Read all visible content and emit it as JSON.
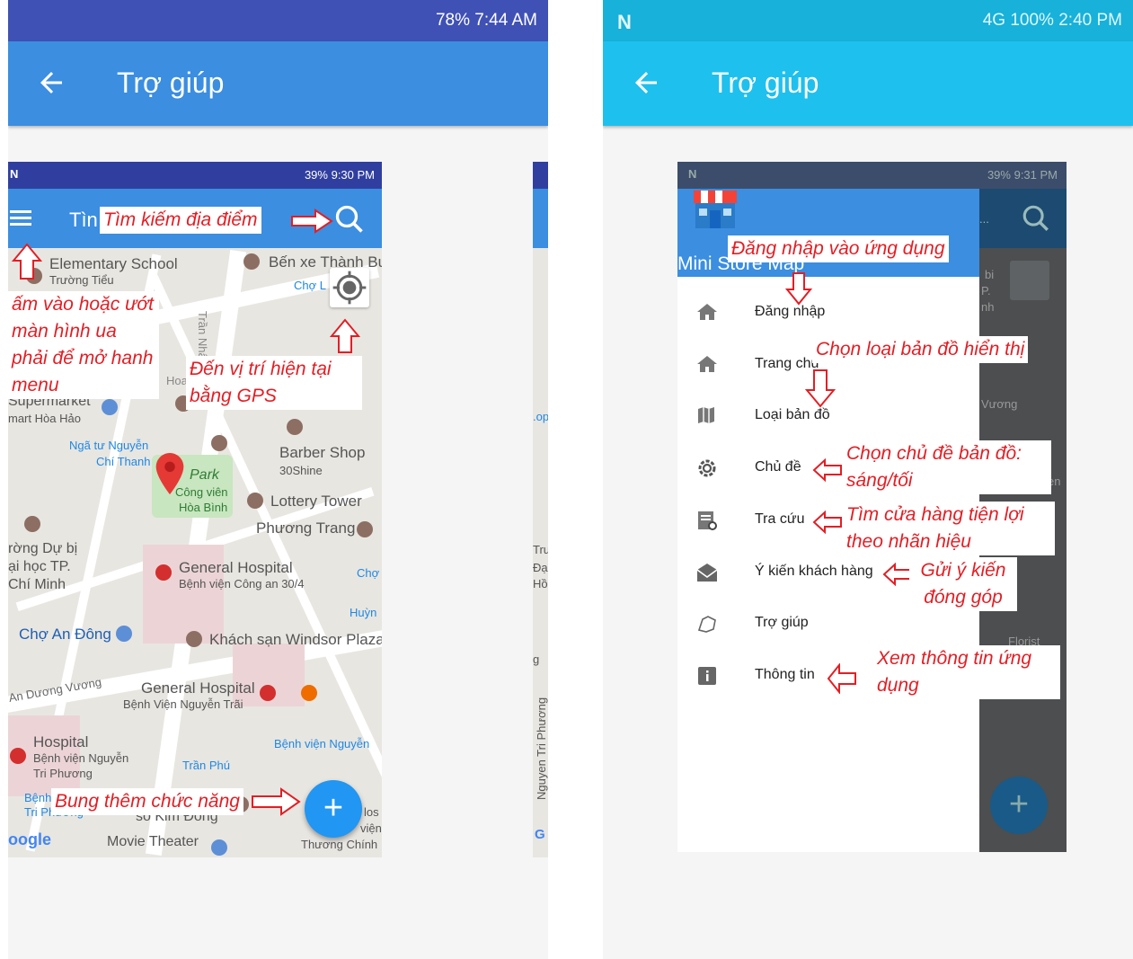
{
  "left": {
    "status_bar": "78%  7:44 AM",
    "title": "Trợ giúp",
    "appbar_color": "#3b8ee0",
    "screenshot": {
      "status_bar": "39%  9:30 PM",
      "toolbar_title_partial": "Tìn",
      "map_labels": {
        "elementary": "Elementary School",
        "truong_tieu": "Trường Tiểu",
        "ben_xe": "Bến xe Thành Bư",
        "cho_le": "Chợ L",
        "tran_nhan_ton": "Trần Nhân Tôn",
        "supermarket": "Supermarket",
        "mart": "mart Hòa Hảo",
        "hoa": "Hoa",
        "nga_tu": "Ngã tư Nguyễn",
        "chi_thanh": "Chí Thanh",
        "barber": "Barber Shop",
        "shine": "30Shine",
        "park": "Park",
        "cong_vien": "Công viên",
        "hoa_binh": "Hòa Bình",
        "lottery": "Lottery Tower",
        "phuong_trang": "Phương Trang",
        "truong_dh1": "rờng Dự bị",
        "truong_dh2": "ại học TP.",
        "truong_dh3": "Chí Minh",
        "general_hospital": "General Hospital",
        "bv_cong_an": "Bệnh viện Công an 30/4",
        "cho": "Chợ",
        "huyn": "Huỳn",
        "cho_an_dong": "Chợ An Đông",
        "windsor": "Khách sạn Windsor Plaza",
        "an_duong_vuong": "An Dương Vương",
        "general_hospital2": "General Hospital",
        "bv_nguyen_trai": "Bệnh Viện Nguyễn Trãi",
        "hospital": "Hospital",
        "bv_nguyen1": "Bệnh viện Nguyễn",
        "tri_phuong": "Tri Phương",
        "bv_nguyen2": "Bệnh viện Nguyễn",
        "tran_phu": "Trần Phú",
        "benh": "Bệnh",
        "tri_phuong2": "Tri Phương",
        "so_kim_dong": "số Kim Đồng",
        "google": "oogle",
        "movie": "Movie Theater",
        "thuong_chinh": "Thương Chính",
        "vien": "viện",
        "los": "los"
      },
      "annotations": {
        "search": "Tìm kiếm địa điểm",
        "menu": "ấm vào hoặc ướt màn hình ua phải để mở hanh menu",
        "gps": "Đến vị trí hiện tại bằng GPS",
        "expand": "Bung thêm chức năng"
      },
      "fab": "+"
    }
  },
  "right": {
    "status_bar": "4G  100%  2:40 PM",
    "title": "Trợ giúp",
    "appbar_color": "#1ec0ee",
    "screenshot": {
      "status_bar": "39%  9:31 PM",
      "drawer_header": "Mini Store Map",
      "menu_items": [
        {
          "label": "Đăng nhập",
          "icon": "home-icon"
        },
        {
          "label": "Trang chủ",
          "icon": "home-icon"
        },
        {
          "label": "Loại bản đồ",
          "icon": "map-icon"
        },
        {
          "label": "Chủ đề",
          "icon": "settings-icon"
        },
        {
          "label": "Tra cứu",
          "icon": "search-list-icon"
        },
        {
          "label": "Ý kiến khách hàng",
          "icon": "mail-icon"
        },
        {
          "label": "Trợ giúp",
          "icon": "help-hand-icon"
        },
        {
          "label": "Thông tin",
          "icon": "info-icon"
        }
      ],
      "annotations": {
        "login": "Đăng nhập vào ứng dụng",
        "map_type": "Chọn loại bản đồ hiển thị",
        "theme": "Chọn chủ đề bản đồ: sáng/tối",
        "lookup": "Tìm cửa hàng tiện lợi theo nhãn hiệu",
        "feedback": "Gửi ý kiến đóng góp",
        "info": "Xem thông tin ứng dụng"
      },
      "bg_labels": {
        "bi": "bi",
        "p": "P.",
        "nh": "nh",
        "vuong": "Vương",
        "en": "en",
        "florist": "Florist"
      },
      "fab": "+"
    }
  },
  "middle_strip": {
    "tru": "Tru",
    "da": "Đạ",
    "ho": "Hồ",
    "op": ".op",
    "g": "g",
    "nguyen_tri_phuong": "Nguyen Tri Phương",
    "g2": "G"
  }
}
